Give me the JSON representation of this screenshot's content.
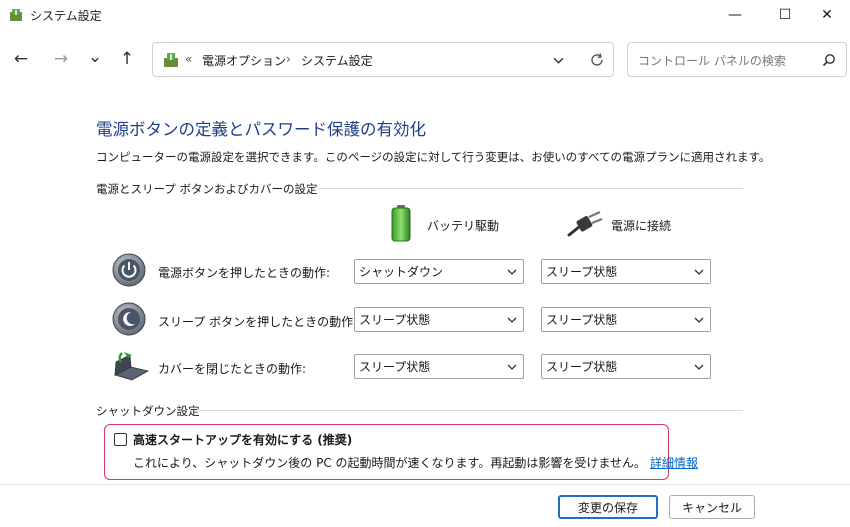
{
  "window": {
    "title": "システム設定",
    "controls": {
      "minimize": "—",
      "maximize": "☐",
      "close": "✕"
    }
  },
  "nav": {
    "back": "←",
    "forward": "→",
    "recent": "⌄",
    "up": "↑",
    "address": {
      "overflow": "«",
      "crumbs": [
        "電源オプション",
        "システム設定"
      ],
      "separator": "›"
    },
    "search": {
      "placeholder": "コントロール パネルの検索"
    }
  },
  "main": {
    "title": "電源ボタンの定義とパスワード保護の有効化",
    "description": "コンピューターの電源設定を選択できます。このページの設定に対して行う変更は、お使いのすべての電源プランに適用されます。",
    "buttons_section": {
      "heading": "電源とスリープ ボタンおよびカバーの設定",
      "columns": {
        "battery": "バッテリ駆動",
        "plugged": "電源に接続"
      },
      "rows": [
        {
          "label": "電源ボタンを押したときの動作:",
          "battery": "シャットダウン",
          "plugged": "スリープ状態"
        },
        {
          "label": "スリープ ボタンを押したときの動作:",
          "battery": "スリープ状態",
          "plugged": "スリープ状態"
        },
        {
          "label": "カバーを閉じたときの動作:",
          "battery": "スリープ状態",
          "plugged": "スリープ状態"
        }
      ]
    },
    "shutdown_section": {
      "heading": "シャットダウン設定",
      "fast_startup": {
        "label": "高速スタートアップを有効にする (推奨)",
        "checked": false,
        "description": "これにより、シャットダウン後の PC の起動時間が速くなります。再起動は影響を受けません。",
        "link": "詳細情報"
      }
    }
  },
  "footer": {
    "save": "変更の保存",
    "cancel": "キャンセル"
  },
  "colors": {
    "title": "#1f3f86",
    "link": "#0066cc",
    "highlight": "#d8385c",
    "primary_border": "#1f6fc5"
  }
}
